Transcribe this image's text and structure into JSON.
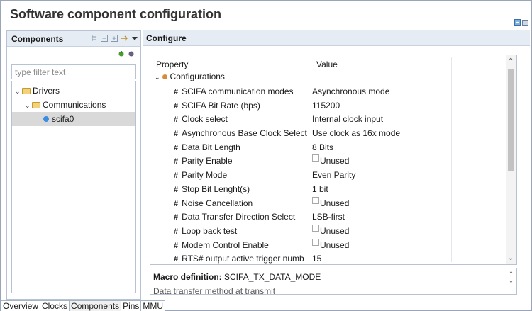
{
  "window": {
    "title": "Software component configuration"
  },
  "components_panel": {
    "title": "Components",
    "filter_placeholder": "type filter text",
    "tree": [
      {
        "label": "Drivers",
        "level": 0,
        "expanded": true
      },
      {
        "label": "Communications",
        "level": 1,
        "expanded": true
      },
      {
        "label": "scifa0",
        "level": 2,
        "selected": true
      }
    ]
  },
  "configure_panel": {
    "title": "Configure",
    "columns": [
      "Property",
      "Value"
    ],
    "root": "Configurations",
    "rows": [
      {
        "property": "SCIFA communication modes",
        "value": "Asynchronous mode",
        "checkbox": false
      },
      {
        "property": "SCIFA Bit Rate (bps)",
        "value": "115200",
        "checkbox": false
      },
      {
        "property": "Clock select",
        "value": "Internal clock input",
        "checkbox": false
      },
      {
        "property": "Asynchronous Base Clock Select",
        "value": "Use clock as 16x mode",
        "checkbox": false
      },
      {
        "property": "Data Bit Length",
        "value": "8 Bits",
        "checkbox": false
      },
      {
        "property": "Parity Enable",
        "value": "Unused",
        "checkbox": true
      },
      {
        "property": "Parity Mode",
        "value": "Even Parity",
        "checkbox": false
      },
      {
        "property": "Stop Bit Lenght(s)",
        "value": "1 bit",
        "checkbox": false
      },
      {
        "property": "Noise Cancellation",
        "value": "Unused",
        "checkbox": true
      },
      {
        "property": "Data Transfer Direction Select",
        "value": "LSB-first",
        "checkbox": false
      },
      {
        "property": "Loop back test",
        "value": "Unused",
        "checkbox": true
      },
      {
        "property": "Modem Control Enable",
        "value": "Unused",
        "checkbox": true
      },
      {
        "property": "RTS# output active trigger numb",
        "value": "15",
        "checkbox": false
      }
    ],
    "macro_label": "Macro definition:",
    "macro_value": "SCIFA_TX_DATA_MODE",
    "macro_desc": "Data transfer method at transmit"
  },
  "tabs": [
    {
      "label": "Overview",
      "active": false
    },
    {
      "label": "Clocks",
      "active": false
    },
    {
      "label": "Components",
      "active": true
    },
    {
      "label": "Pins",
      "active": false
    },
    {
      "label": "MMU",
      "active": false
    }
  ],
  "colors": {
    "header_bg": "#e6ecf4",
    "border": "#b7c3d3",
    "selection": "#d9d9d9"
  }
}
